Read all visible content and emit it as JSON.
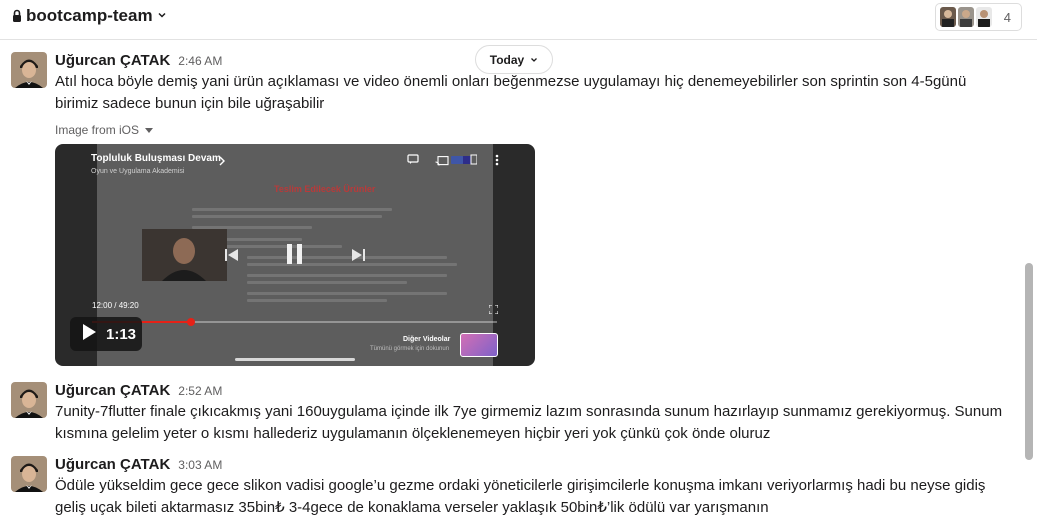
{
  "header": {
    "channel_name": "bootcamp-team",
    "member_count": "4"
  },
  "date_divider": {
    "label": "Today"
  },
  "messages": [
    {
      "author": "Uğurcan ÇATAK",
      "time": "2:46 AM",
      "text": "Atıl hoca böyle demiş yani ürün açıklaması ve video önemli onları beğenmezse uygulamayı hiç denemeyebilirler son sprintin son 4-5günü birimiz sadece bunun için bile uğraşabilir",
      "attachment_label": "Image from iOS"
    },
    {
      "author": "Uğurcan ÇATAK",
      "time": "2:52 AM",
      "text": "7unity-7flutter finale çıkıcakmış yani 160uygulama içinde ilk 7ye girmemiz lazım sonrasında sunum hazırlayıp sunmamız gerekiyormuş. Sunum kısmına gelelim yeter o kısmı hallederiz uygulamanın ölçeklenemeyen hiçbir yeri yok çünkü çok önde oluruz"
    },
    {
      "author": "Uğurcan ÇATAK",
      "time": "3:03 AM",
      "text": "Ödüle yükseldim gece gece slikon vadisi google’u gezme ordaki yöneticilerle girişimcilerle konuşma imkanı veriyorlarmış hadi bu neyse gidiş geliş uçak bileti aktarmasız 35bin₺ 3-4gece de konaklama verseler yaklaşık 50bin₺’lik ödülü var yarışmanın"
    }
  ],
  "video": {
    "top_title": "Topluluk Buluşması Devam",
    "top_subtitle": "Oyun ve Uygulama Akademisi",
    "slide_title": "Teslim Edilecek Ürünler",
    "timestamp": "12:00 / 49:20",
    "progress_fraction": 0.244,
    "play_label": "1:13",
    "related_label": "Diğer Videolar",
    "related_sub": "Tümünü görmek için dokunun"
  },
  "colors": {
    "accent_red": "#e62117",
    "text_primary": "#1d1c1d",
    "text_secondary": "#616061"
  }
}
